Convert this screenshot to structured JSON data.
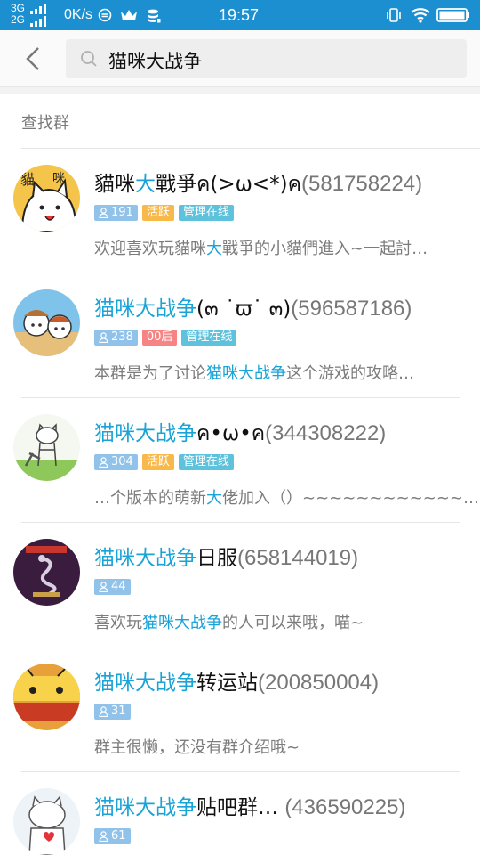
{
  "status_bar": {
    "net_top": "3G",
    "net_bottom": "2G",
    "speed": "0K/s",
    "time": "19:57"
  },
  "header": {
    "search_value": "猫咪大战争"
  },
  "section_title": "查找群",
  "groups": [
    {
      "name_pre": "貓咪",
      "name_hl": "大",
      "name_post": "戰爭ค(>ω<*)ค",
      "id": "(581758224)",
      "members": "191",
      "tag2": "活跃",
      "tag3": "管理在线",
      "desc_pre": "欢迎喜欢玩貓咪",
      "desc_hl": "大",
      "desc_post": "戰爭的小貓們進入~一起討…"
    },
    {
      "name_pre": "",
      "name_hl": "猫咪大战争",
      "name_post": "(๓ ˙ϖ˙ ๓)",
      "id": "(596587186)",
      "members": "238",
      "tag2": "00后",
      "tag3": "管理在线",
      "desc_pre": "本群是为了讨论",
      "desc_hl": "猫咪大战争",
      "desc_post": "这个游戏的攻略…"
    },
    {
      "name_pre": "",
      "name_hl": "猫咪大战争",
      "name_post": "ค•ω•ค",
      "id": "(344308222)",
      "members": "304",
      "tag2": "活跃",
      "tag3": "管理在线",
      "desc_pre": "…个版本的萌新",
      "desc_hl": "大",
      "desc_post": "佬加入（）~~~~~~~~~~~~…"
    },
    {
      "name_pre": "",
      "name_hl": "猫咪大战争",
      "name_post": "日服",
      "id": "(658144019)",
      "members": "44",
      "tag2": "",
      "tag3": "",
      "desc_pre": "喜欢玩",
      "desc_hl": "猫咪大战争",
      "desc_post": "的人可以来哦，喵~"
    },
    {
      "name_pre": "",
      "name_hl": "猫咪大战争",
      "name_post": "转运站",
      "id": "(200850004)",
      "members": "31",
      "tag2": "",
      "tag3": "",
      "desc_pre": "群主很懒，还没有群介绍哦~",
      "desc_hl": "",
      "desc_post": ""
    },
    {
      "name_pre": "",
      "name_hl": "猫咪大战争",
      "name_post": "贴吧群…  ",
      "id": "(436590225)",
      "members": "61",
      "tag2": "",
      "tag3": "",
      "desc_pre": "",
      "desc_hl": "",
      "desc_post": ""
    }
  ]
}
